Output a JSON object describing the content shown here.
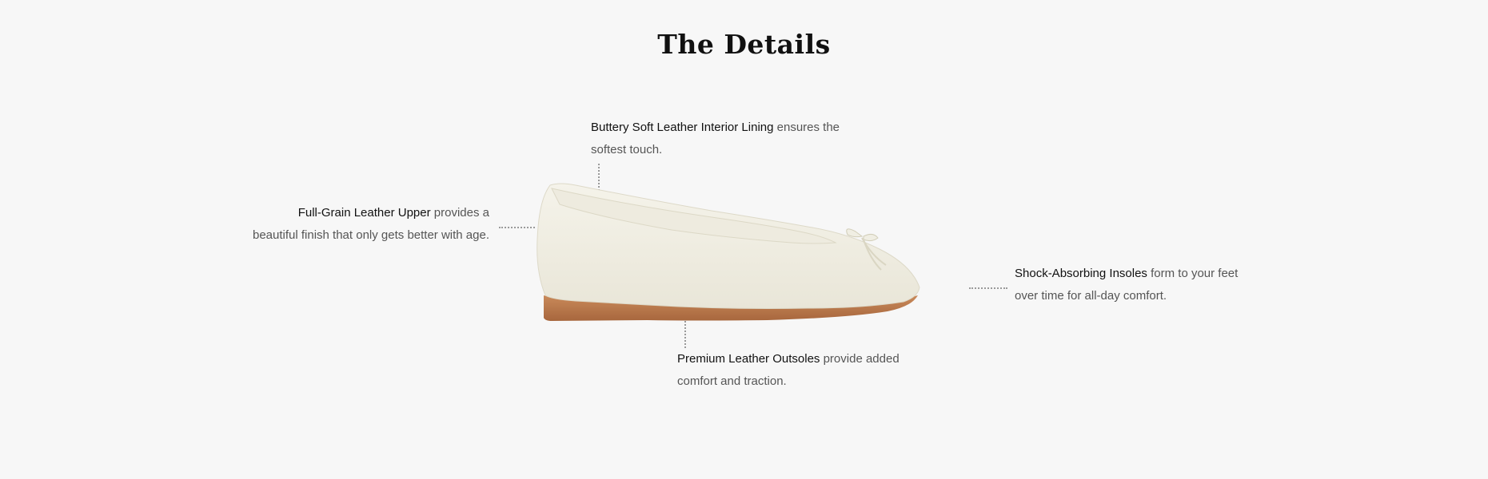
{
  "section": {
    "title": "The Details"
  },
  "callouts": [
    {
      "strong": "Buttery Soft Leather Interior Lining",
      "text": " ensures the softest touch."
    },
    {
      "strong": "Full-Grain Leather Upper",
      "text": " provides a beautiful finish that only gets better with age."
    },
    {
      "strong": "Shock-Absorbing Insoles",
      "text": " form to your feet over time for all-day comfort."
    },
    {
      "strong": "Premium Leather Outsoles",
      "text": " provide added comfort and traction."
    }
  ],
  "colors": {
    "background": "#f7f7f7",
    "shoe_leather": "#f1efe4",
    "sole": "#b8764a"
  }
}
